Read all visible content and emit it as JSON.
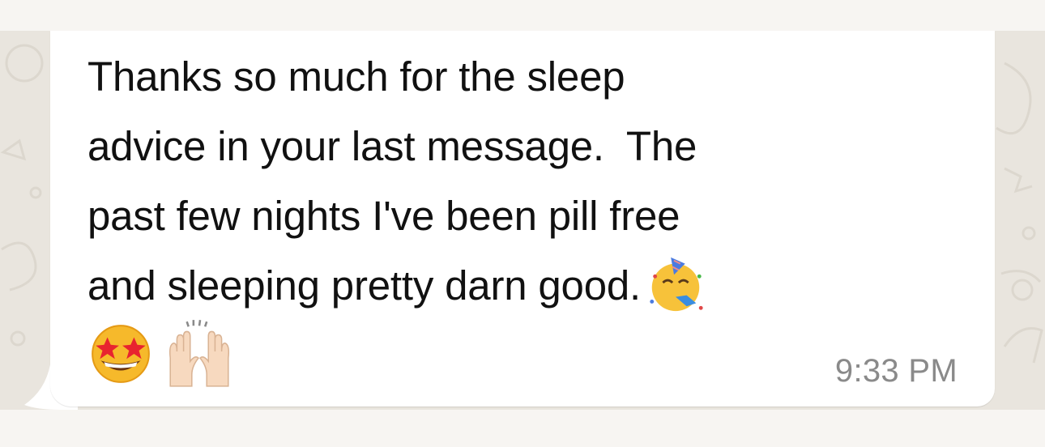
{
  "message": {
    "lines": [
      "Thanks so much for the sleep",
      "advice in your last message.  The",
      "past few nights I've been pill free",
      "and sleeping pretty darn good."
    ],
    "timestamp": "9:33 PM",
    "emojis": [
      "partying-face-emoji",
      "star-struck-emoji",
      "raising-hands-emoji"
    ]
  },
  "colors": {
    "bubble": "#ffffff",
    "wallpaper": "#e9e5de",
    "text": "#111111",
    "timestamp": "#8a8a8a"
  }
}
